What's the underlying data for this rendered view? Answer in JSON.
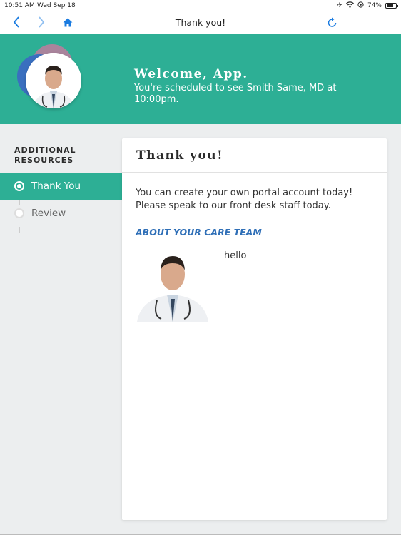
{
  "status_bar": {
    "time": "10:51 AM",
    "date": "Wed Sep 18",
    "battery_percent": "74%",
    "battery_level": 0.74,
    "icons": [
      "airplane-icon",
      "wifi-icon",
      "location-lock-icon",
      "battery-icon"
    ]
  },
  "nav": {
    "title": "Thank you!",
    "back_icon": "chevron-left-icon",
    "forward_icon": "chevron-right-icon",
    "home_icon": "home-icon",
    "refresh_icon": "refresh-icon"
  },
  "header": {
    "greeting": "Welcome, App.",
    "appointment": "You're scheduled to see Smith Same, MD at 10:00pm.",
    "colors": {
      "background": "#2daf95",
      "accent_purple": "#a9849c",
      "accent_blue": "#3a6fbf"
    }
  },
  "sidebar": {
    "heading": "ADDITIONAL RESOURCES",
    "items": [
      {
        "label": "Thank You",
        "active": true
      },
      {
        "label": "Review",
        "active": false
      }
    ]
  },
  "card": {
    "title": "Thank you!",
    "message_line1": "You can create your own portal account today!",
    "message_line2": "Please speak to our front desk staff today.",
    "care_team_title": "ABOUT YOUR CARE TEAM",
    "care_team": [
      {
        "name": "hello",
        "photo": "doctor-photo"
      }
    ]
  }
}
